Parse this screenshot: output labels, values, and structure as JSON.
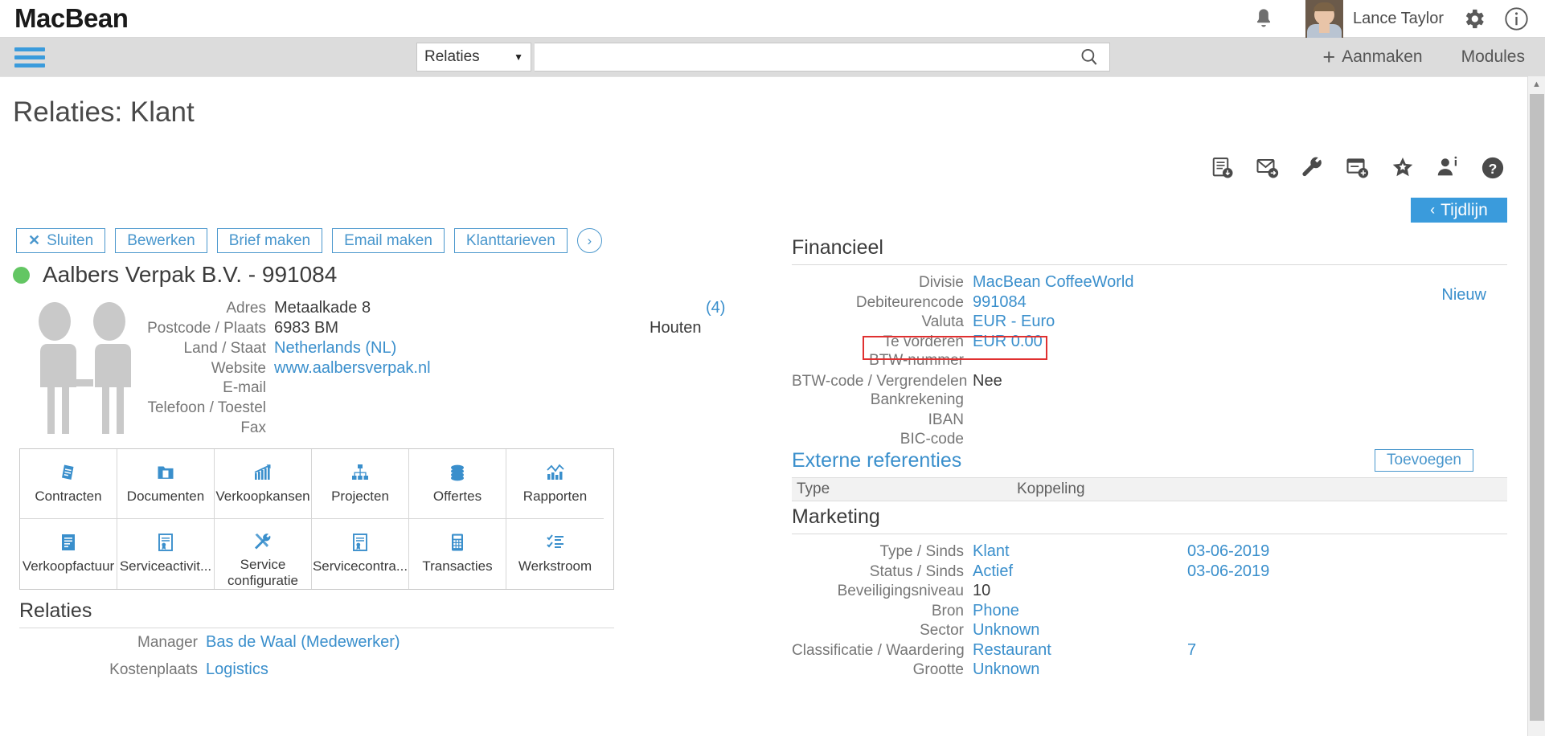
{
  "brand": {
    "logo": "MacBean",
    "user_name": "Lance Taylor",
    "bell_icon": "bell-icon",
    "gear_icon": "gear-icon",
    "info_icon": "info-icon"
  },
  "navbar": {
    "search_scope": "Relaties",
    "search_value": "",
    "search_placeholder": "",
    "caret": "▼",
    "aanmaken_label": "Aanmaken",
    "aanmaken_plus": "+",
    "modules_label": "Modules"
  },
  "page": {
    "title": "Relaties: Klant"
  },
  "actions": [
    {
      "label": "Sluiten",
      "icon": "✕"
    },
    {
      "label": "Bewerken"
    },
    {
      "label": "Brief maken"
    },
    {
      "label": "Email maken"
    },
    {
      "label": "Klanttarieven"
    }
  ],
  "action_more": "›",
  "toolbar_icons": [
    "document-download-icon",
    "email-forward-icon",
    "wrench-icon",
    "window-add-icon",
    "star-icon",
    "person-info-icon",
    "help-icon"
  ],
  "tijdlijn": {
    "label": "Tijdlijn",
    "chevron": "‹"
  },
  "scrollbar": {
    "up_arrow": "▲"
  },
  "company": {
    "status": "active",
    "status_color": "#63c663",
    "name": "Aalbers Verpak B.V. - 991084",
    "fields": [
      {
        "label": "Adres",
        "value": "Metaalkade 8",
        "link": false
      },
      {
        "label": "Postcode / Plaats",
        "value": "6983 BM",
        "link": false
      },
      {
        "label": "Land / Staat",
        "value": "Netherlands (NL)",
        "link": true
      },
      {
        "label": "Website",
        "value": "www.aalbersverpak.nl",
        "link": true
      },
      {
        "label": "E-mail",
        "value": "",
        "link": false
      },
      {
        "label": "Telefoon / Toestel",
        "value": "",
        "link": false
      },
      {
        "label": "Fax",
        "value": "",
        "link": false
      }
    ],
    "address_count": "(4)",
    "city": "Houten"
  },
  "tiles": [
    {
      "label": "Contracten",
      "icon": "contract-icon"
    },
    {
      "label": "Documenten",
      "icon": "folder-document-icon"
    },
    {
      "label": "Verkoopkansen",
      "icon": "chart-growth-icon"
    },
    {
      "label": "Projecten",
      "icon": "hierarchy-icon"
    },
    {
      "label": "Offertes",
      "icon": "coins-icon"
    },
    {
      "label": "Rapporten",
      "icon": "bar-chart-icon"
    },
    {
      "label": "Verkoopfactuur",
      "icon": "invoice-icon"
    },
    {
      "label": "Serviceactivit...",
      "icon": "certificate-icon"
    },
    {
      "label": "Service configuratie",
      "icon": "wrench-screwdriver-icon"
    },
    {
      "label": "Servicecontra...",
      "icon": "certificate-icon"
    },
    {
      "label": "Transacties",
      "icon": "calculator-icon"
    },
    {
      "label": "Werkstroom",
      "icon": "checklist-icon"
    }
  ],
  "relaties": {
    "heading": "Relaties",
    "rows": [
      {
        "label": "Manager",
        "value": "Bas de Waal (Medewerker)",
        "link": true
      },
      {
        "label": "Kostenplaats",
        "value": "Logistics",
        "link": true
      }
    ]
  },
  "financieel": {
    "heading": "Financieel",
    "nieuw_label": "Nieuw",
    "rows": [
      {
        "label": "Divisie",
        "value": "MacBean CoffeeWorld",
        "link": true
      },
      {
        "label": "Debiteurencode",
        "value": "991084",
        "link": true
      },
      {
        "label": "Valuta",
        "value": "EUR - Euro",
        "link": true
      },
      {
        "label": "Te vorderen",
        "value": "EUR 0.00",
        "link": true
      },
      {
        "label": "BTW-nummer",
        "value": "",
        "link": false,
        "highlighted": true
      },
      {
        "label": "BTW-code / Vergrendelen",
        "value": "Nee",
        "link": false
      },
      {
        "label": "Bankrekening",
        "value": "",
        "link": false
      },
      {
        "label": "IBAN",
        "value": "",
        "link": false
      },
      {
        "label": "BIC-code",
        "value": "",
        "link": false
      }
    ],
    "highlight_color": "#e03030"
  },
  "externe_referenties": {
    "heading": "Externe referenties",
    "add_label": "Toevoegen",
    "columns": [
      "Type",
      "Koppeling"
    ],
    "rows": []
  },
  "marketing": {
    "heading": "Marketing",
    "rows": [
      {
        "label": "Type / Sinds",
        "value": "Klant",
        "link": true,
        "value2": "03-06-2019"
      },
      {
        "label": "Status / Sinds",
        "value": "Actief",
        "link": true,
        "value2": "03-06-2019"
      },
      {
        "label": "Beveiligingsniveau",
        "value": "10",
        "link": false,
        "value2": ""
      },
      {
        "label": "Bron",
        "value": "Phone",
        "link": true,
        "value2": ""
      },
      {
        "label": "Sector",
        "value": "Unknown",
        "link": true,
        "value2": ""
      },
      {
        "label": "Classificatie / Waardering",
        "value": "Restaurant",
        "link": true,
        "value2": "7"
      },
      {
        "label": "Grootte",
        "value": "Unknown",
        "link": true,
        "value2": ""
      }
    ]
  }
}
